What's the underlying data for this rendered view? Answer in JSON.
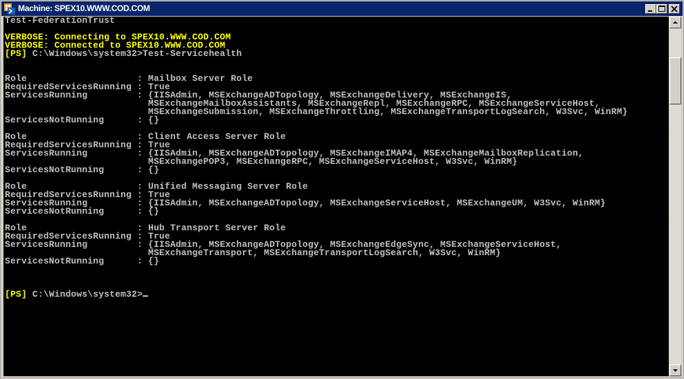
{
  "window": {
    "title": "Machine: SPEX10.WWW.COD.COM",
    "icon": "powershell-icon",
    "controls": {
      "minimize": "minimize-icon",
      "maximize": "maximize-icon",
      "close": "close-icon"
    }
  },
  "console": {
    "colors": {
      "background": "#000000",
      "text": "#c0c0c0",
      "highlight": "#ffff00"
    },
    "lines": [
      {
        "text": "Test-FederationTrust",
        "color": "normal"
      },
      {
        "text": "",
        "color": "normal"
      },
      {
        "text": "VERBOSE: Connecting to SPEX10.WWW.COD.COM",
        "color": "yellow"
      },
      {
        "text": "VERBOSE: Connected to SPEX10.WWW.COD.COM",
        "color": "yellow"
      },
      {
        "prompt": "[PS]",
        "path": " C:\\Windows\\system32>",
        "command": "Test-Servicehealth"
      },
      {
        "text": "",
        "color": "normal"
      },
      {
        "text": "",
        "color": "normal"
      },
      {
        "text": "Role                    : Mailbox Server Role",
        "color": "normal"
      },
      {
        "text": "RequiredServicesRunning : True",
        "color": "normal"
      },
      {
        "text": "ServicesRunning         : {IISAdmin, MSExchangeADTopology, MSExchangeDelivery, MSExchangeIS,",
        "color": "normal"
      },
      {
        "text": "                          MSExchangeMailboxAssistants, MSExchangeRepl, MSExchangeRPC, MSExchangeServiceHost,",
        "color": "normal"
      },
      {
        "text": "                          MSExchangeSubmission, MSExchangeThrottling, MSExchangeTransportLogSearch, W3Svc, WinRM}",
        "color": "normal"
      },
      {
        "text": "ServicesNotRunning      : {}",
        "color": "normal"
      },
      {
        "text": "",
        "color": "normal"
      },
      {
        "text": "Role                    : Client Access Server Role",
        "color": "normal"
      },
      {
        "text": "RequiredServicesRunning : True",
        "color": "normal"
      },
      {
        "text": "ServicesRunning         : {IISAdmin, MSExchangeADTopology, MSExchangeIMAP4, MSExchangeMailboxReplication,",
        "color": "normal"
      },
      {
        "text": "                          MSExchangePOP3, MSExchangeRPC, MSExchangeServiceHost, W3Svc, WinRM}",
        "color": "normal"
      },
      {
        "text": "ServicesNotRunning      : {}",
        "color": "normal"
      },
      {
        "text": "",
        "color": "normal"
      },
      {
        "text": "Role                    : Unified Messaging Server Role",
        "color": "normal"
      },
      {
        "text": "RequiredServicesRunning : True",
        "color": "normal"
      },
      {
        "text": "ServicesRunning         : {IISAdmin, MSExchangeADTopology, MSExchangeServiceHost, MSExchangeUM, W3Svc, WinRM}",
        "color": "normal"
      },
      {
        "text": "ServicesNotRunning      : {}",
        "color": "normal"
      },
      {
        "text": "",
        "color": "normal"
      },
      {
        "text": "Role                    : Hub Transport Server Role",
        "color": "normal"
      },
      {
        "text": "RequiredServicesRunning : True",
        "color": "normal"
      },
      {
        "text": "ServicesRunning         : {IISAdmin, MSExchangeADTopology, MSExchangeEdgeSync, MSExchangeServiceHost,",
        "color": "normal"
      },
      {
        "text": "                          MSExchangeTransport, MSExchangeTransportLogSearch, W3Svc, WinRM}",
        "color": "normal"
      },
      {
        "text": "ServicesNotRunning      : {}",
        "color": "normal"
      },
      {
        "text": "",
        "color": "normal"
      },
      {
        "text": "",
        "color": "normal"
      },
      {
        "text": "",
        "color": "normal"
      },
      {
        "prompt": "[PS]",
        "path": " C:\\Windows\\system32>",
        "command": "",
        "cursor": true
      }
    ]
  },
  "scrollbar": {
    "position_fraction": 0.1,
    "visible_fraction": 0.14,
    "up_icon": "arrow-up-icon",
    "down_icon": "arrow-down-icon"
  }
}
